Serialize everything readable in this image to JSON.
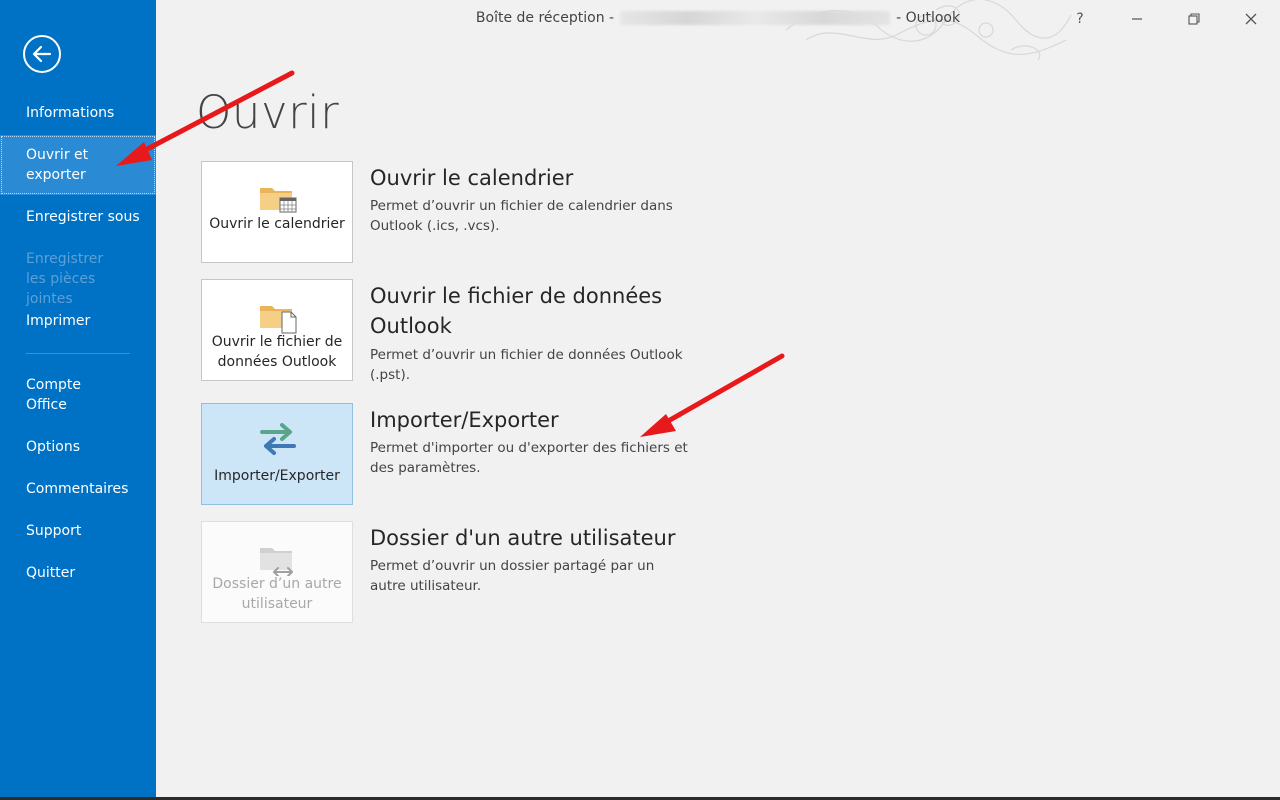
{
  "window": {
    "title_prefix": "Boîte de réception -",
    "title_suffix": "- Outlook",
    "help_label": "?",
    "minimize_label": "—",
    "restore_label": "❐",
    "close_label": "✕"
  },
  "sidebar": {
    "back_icon": "back-arrow-icon",
    "items": [
      {
        "label": "Informations",
        "state": "normal"
      },
      {
        "label": "Ouvrir et exporter",
        "state": "selected"
      },
      {
        "label": "Enregistrer sous",
        "state": "normal"
      },
      {
        "label": "Enregistrer les pièces jointes",
        "state": "disabled"
      },
      {
        "label": "Imprimer",
        "state": "normal"
      },
      {
        "label": "Compte Office",
        "state": "normal"
      },
      {
        "label": "Options",
        "state": "normal"
      },
      {
        "label": "Commentaires",
        "state": "normal"
      },
      {
        "label": "Support",
        "state": "normal"
      },
      {
        "label": "Quitter",
        "state": "normal"
      }
    ]
  },
  "main": {
    "title": "Ouvrir",
    "options": [
      {
        "tile_label": "Ouvrir le calendrier",
        "icon": "calendar-folder-icon",
        "heading": "Ouvrir le calendrier",
        "description": "Permet d’ouvrir un fichier de calendrier dans Outlook (.ics, .vcs).",
        "state": "normal"
      },
      {
        "tile_label": "Ouvrir le fichier de données Outlook",
        "icon": "data-file-folder-icon",
        "heading": "Ouvrir le fichier de données Outlook",
        "description": "Permet d’ouvrir un fichier de données Outlook (.pst).",
        "state": "normal"
      },
      {
        "tile_label": "Importer/Exporter",
        "icon": "import-export-arrows-icon",
        "heading": "Importer/Exporter",
        "description": "Permet d'importer ou d'exporter des fichiers et des paramètres.",
        "state": "highlighted"
      },
      {
        "tile_label": "Dossier d’un autre utilisateur",
        "icon": "shared-folder-icon",
        "heading": "Dossier d'un autre utilisateur",
        "description": "Permet d’ouvrir un dossier partagé par un autre utilisateur.",
        "state": "disabled"
      }
    ]
  },
  "colors": {
    "sidebar_bg": "#0072c6",
    "sidebar_selected": "#2a8ad4",
    "tile_highlight": "#cde6f7",
    "annotation_arrow": "#e8191b"
  }
}
